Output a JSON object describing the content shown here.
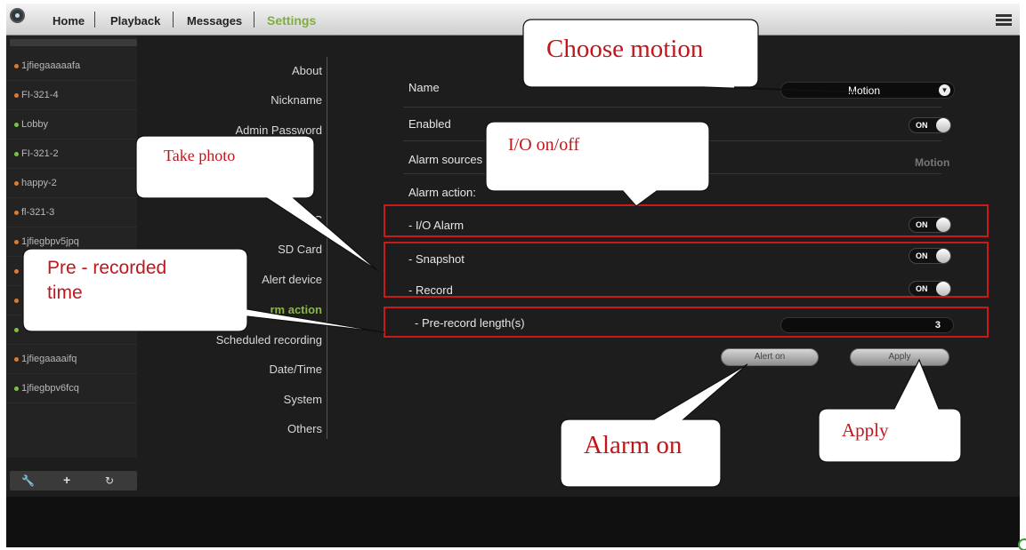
{
  "nav": {
    "home": "Home",
    "playback": "Playback",
    "messages": "Messages",
    "settings": "Settings"
  },
  "devices": [
    {
      "name": "1jfiegaaaaafa",
      "status_color": "#e07a2e"
    },
    {
      "name": "FI-321-4",
      "status_color": "#e07a2e"
    },
    {
      "name": "Lobby",
      "status_color": "#7fc241"
    },
    {
      "name": "FI-321-2",
      "status_color": "#7fc241"
    },
    {
      "name": "happy-2",
      "status_color": "#e07a2e"
    },
    {
      "name": "fl-321-3",
      "status_color": "#e07a2e"
    },
    {
      "name": "1jfiegbpv5jpq",
      "status_color": "#e07a2e"
    },
    {
      "name": "",
      "status_color": "#e07a2e"
    },
    {
      "name": "",
      "status_color": "#e07a2e"
    },
    {
      "name": "",
      "status_color": "#7fc241"
    },
    {
      "name": "1jfiegaaaaifq",
      "status_color": "#e07a2e"
    },
    {
      "name": "1jfiegbpv6fcq",
      "status_color": "#7fc241"
    }
  ],
  "device_tools": [
    "wrench-icon",
    "plus-icon",
    "refresh-icon"
  ],
  "settings_menu": {
    "about": "About",
    "nickname": "Nickname",
    "admin_password": "Admin Password",
    "hidden_item": "C",
    "sd_card": "SD Card",
    "alert_device": "Alert device",
    "alarm_action": "rm action",
    "scheduled_recording": "Scheduled recording",
    "date_time": "Date/Time",
    "system": "System",
    "others": "Others"
  },
  "form": {
    "name_label": "Name",
    "name_value": "Motion",
    "enabled_label": "Enabled",
    "enabled_state": "ON",
    "alarm_sources_label": "Alarm sources",
    "alarm_sources_value": "Motion",
    "alarm_action_label": "Alarm action:",
    "io_alarm_label": "- I/O Alarm",
    "io_alarm_state": "ON",
    "snapshot_label": "- Snapshot",
    "snapshot_state": "ON",
    "record_label": "- Record",
    "record_state": "ON",
    "prerecord_label": "- Pre-record length(s)",
    "prerecord_value": "3",
    "alert_on_button": "Alert on",
    "apply_button": "Apply"
  },
  "callouts": {
    "choose_motion": "Choose motion",
    "io_onoff": "I/O on/off",
    "take_photo": "Take photo",
    "prerecorded_line1": "Pre - recorded",
    "prerecorded_line2": "time",
    "alarm_on": "Alarm on",
    "apply": "Apply"
  },
  "colors": {
    "accent": "#8ab64c",
    "annotation": "#c0161c"
  }
}
